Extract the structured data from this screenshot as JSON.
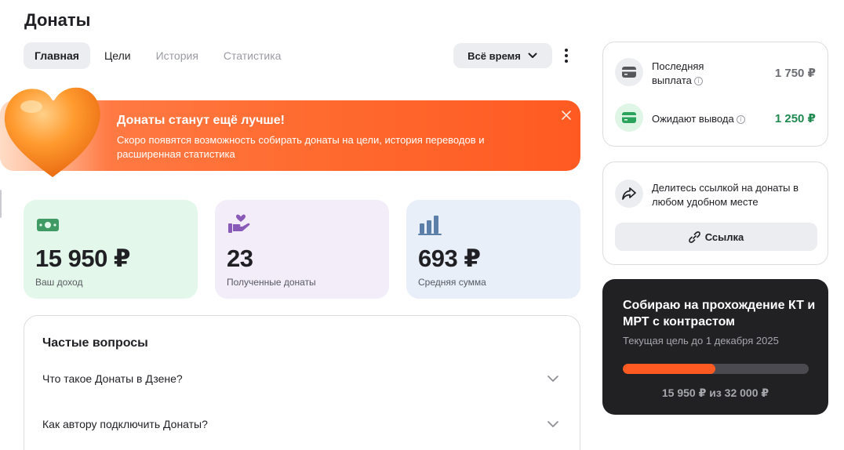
{
  "page": {
    "title": "Донаты"
  },
  "tabs": [
    {
      "label": "Главная",
      "state": "active"
    },
    {
      "label": "Цели",
      "state": "normal"
    },
    {
      "label": "История",
      "state": "disabled"
    },
    {
      "label": "Статистика",
      "state": "disabled"
    }
  ],
  "filter": {
    "period_label": "Всё время",
    "icon": "chevron-down-icon"
  },
  "banner": {
    "title": "Донаты станут ещё лучше!",
    "text": "Скоро появятся возможность собирать донаты на цели, история переводов и расширенная статистика",
    "icon": "heart-icon",
    "gradient_start": "#ff7a44",
    "gradient_end": "#ff5a22"
  },
  "stats": [
    {
      "value": "15 950 ₽",
      "label": "Ваш доход",
      "icon": "money-icon",
      "bg": "#e3f8ea",
      "icon_color": "#3f9a63"
    },
    {
      "value": "23",
      "label": "Полученные донаты",
      "icon": "hand-heart-icon",
      "bg": "#f3ecf9",
      "icon_color": "#8a5ab8"
    },
    {
      "value": "693 ₽",
      "label": "Средняя сумма",
      "icon": "bar-chart-icon",
      "bg": "#e8eff9",
      "icon_color": "#5b7fa8"
    }
  ],
  "faq": {
    "title": "Частые вопросы",
    "items": [
      {
        "question": "Что такое Донаты в Дзене?"
      },
      {
        "question": "Как автору подключить Донаты?"
      }
    ]
  },
  "payouts": {
    "last": {
      "label": "Последняя выплата",
      "amount": "1 750 ₽",
      "color": "#6b6d73"
    },
    "pending": {
      "label": "Ожидают вывода",
      "amount": "1 250 ₽",
      "color": "#1e8a4f"
    }
  },
  "share": {
    "text": "Делитесь ссылкой на донаты в любом удобном месте",
    "button_label": "Ссылка"
  },
  "goal": {
    "title": "Собираю на прохождение КТ и МРТ с контрастом",
    "deadline": "Текущая цель до 1 декабря 2025",
    "amount": "15 950 ₽ из 32 000 ₽",
    "progress": 0.498,
    "accent": "#ff5a22"
  }
}
